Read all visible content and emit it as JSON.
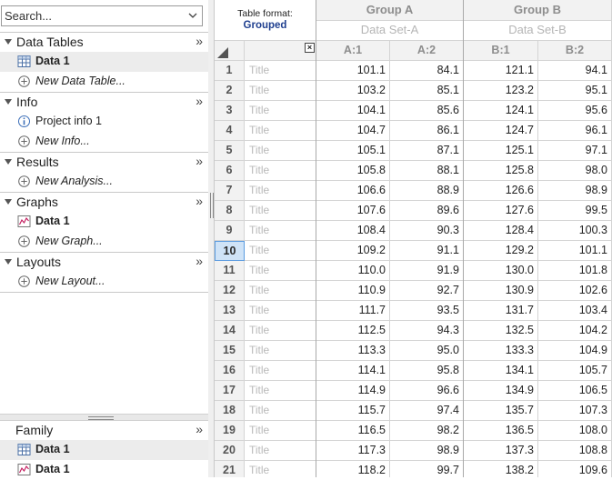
{
  "search": {
    "placeholder": "Search..."
  },
  "navigator": {
    "sections": [
      {
        "id": "data-tables",
        "title": "Data Tables",
        "items": [
          {
            "label": "Data 1",
            "icon": "table-icon",
            "bold": true,
            "selected": true
          },
          {
            "label": "New Data Table...",
            "icon": "add-circle-icon",
            "italic": true
          }
        ]
      },
      {
        "id": "info",
        "title": "Info",
        "items": [
          {
            "label": "Project info 1",
            "icon": "info-icon"
          },
          {
            "label": "New Info...",
            "icon": "add-circle-icon",
            "italic": true
          }
        ]
      },
      {
        "id": "results",
        "title": "Results",
        "items": [
          {
            "label": "New Analysis...",
            "icon": "add-circle-icon",
            "italic": true
          }
        ]
      },
      {
        "id": "graphs",
        "title": "Graphs",
        "items": [
          {
            "label": "Data 1",
            "icon": "graph-icon",
            "bold": true
          },
          {
            "label": "New Graph...",
            "icon": "add-circle-icon",
            "italic": true
          }
        ]
      },
      {
        "id": "layouts",
        "title": "Layouts",
        "items": [
          {
            "label": "New Layout...",
            "icon": "add-circle-icon",
            "italic": true
          }
        ]
      }
    ],
    "expand_glyph": "»"
  },
  "family": {
    "title": "Family",
    "items": [
      {
        "label": "Data 1",
        "icon": "table-icon",
        "bold": true,
        "selected": true
      },
      {
        "label": "Data 1",
        "icon": "graph-icon",
        "bold": true
      }
    ]
  },
  "sheet": {
    "table_format_label": "Table format:",
    "table_format_value": "Grouped",
    "close_glyph": "×",
    "groups": [
      {
        "name": "Group A",
        "dataset": "Data Set-A",
        "columns": [
          "A:1",
          "A:2"
        ]
      },
      {
        "name": "Group B",
        "dataset": "Data Set-B",
        "columns": [
          "B:1",
          "B:2"
        ]
      }
    ],
    "title_placeholder": "Title",
    "current_row": 10,
    "rows": [
      [
        "1",
        "101.1",
        "84.1",
        "121.1",
        "94.1"
      ],
      [
        "2",
        "103.2",
        "85.1",
        "123.2",
        "95.1"
      ],
      [
        "3",
        "104.1",
        "85.6",
        "124.1",
        "95.6"
      ],
      [
        "4",
        "104.7",
        "86.1",
        "124.7",
        "96.1"
      ],
      [
        "5",
        "105.1",
        "87.1",
        "125.1",
        "97.1"
      ],
      [
        "6",
        "105.8",
        "88.1",
        "125.8",
        "98.0"
      ],
      [
        "7",
        "106.6",
        "88.9",
        "126.6",
        "98.9"
      ],
      [
        "8",
        "107.6",
        "89.6",
        "127.6",
        "99.5"
      ],
      [
        "9",
        "108.4",
        "90.3",
        "128.4",
        "100.3"
      ],
      [
        "10",
        "109.2",
        "91.1",
        "129.2",
        "101.1"
      ],
      [
        "11",
        "110.0",
        "91.9",
        "130.0",
        "101.8"
      ],
      [
        "12",
        "110.9",
        "92.7",
        "130.9",
        "102.6"
      ],
      [
        "13",
        "111.7",
        "93.5",
        "131.7",
        "103.4"
      ],
      [
        "14",
        "112.5",
        "94.3",
        "132.5",
        "104.2"
      ],
      [
        "15",
        "113.3",
        "95.0",
        "133.3",
        "104.9"
      ],
      [
        "16",
        "114.1",
        "95.8",
        "134.1",
        "105.7"
      ],
      [
        "17",
        "114.9",
        "96.6",
        "134.9",
        "106.5"
      ],
      [
        "18",
        "115.7",
        "97.4",
        "135.7",
        "107.3"
      ],
      [
        "19",
        "116.5",
        "98.2",
        "136.5",
        "108.0"
      ],
      [
        "20",
        "117.3",
        "98.9",
        "137.3",
        "108.8"
      ],
      [
        "21",
        "118.2",
        "99.7",
        "138.2",
        "109.6"
      ]
    ]
  },
  "colors": {
    "selected_row": "#cfe3f7",
    "format_value": "#1f3f8f",
    "header_bg": "#f2f2f2"
  }
}
